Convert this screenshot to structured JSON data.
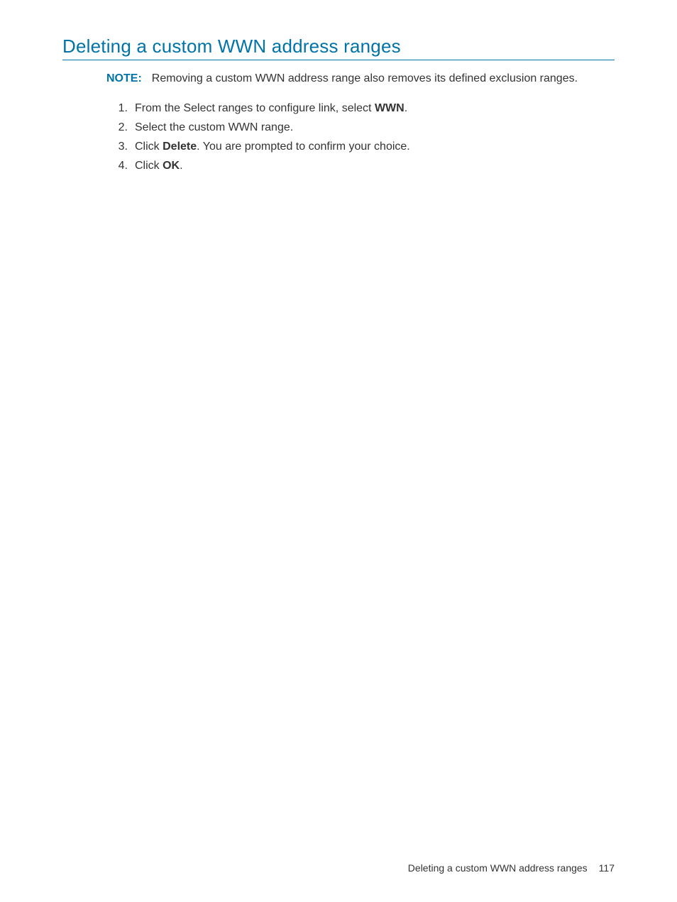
{
  "heading": "Deleting a custom WWN address ranges",
  "note": {
    "label": "NOTE:",
    "text": "Removing a custom WWN address range also removes its defined exclusion ranges."
  },
  "steps": [
    {
      "pre": "From the Select ranges to configure link, select ",
      "bold": "WWN",
      "post": "."
    },
    {
      "pre": "Select the custom WWN range.",
      "bold": "",
      "post": ""
    },
    {
      "pre": "Click ",
      "bold": "Delete",
      "post": ". You are prompted to confirm your choice."
    },
    {
      "pre": "Click ",
      "bold": "OK",
      "post": "."
    }
  ],
  "footer": {
    "title": "Deleting a custom WWN address ranges",
    "page": "117"
  }
}
